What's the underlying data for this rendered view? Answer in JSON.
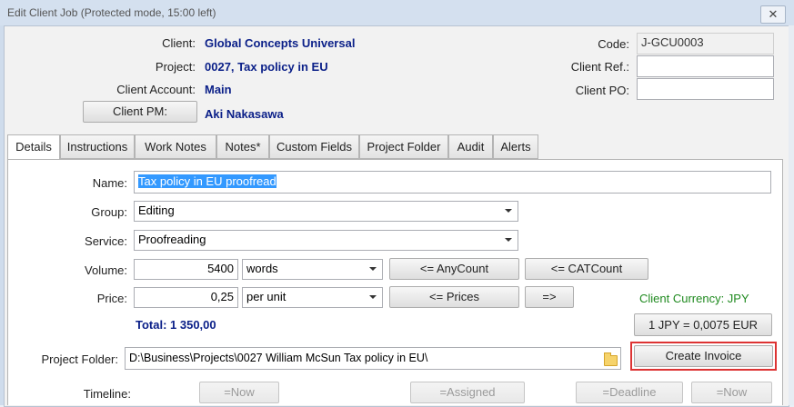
{
  "window": {
    "title": "Edit Client Job (Protected mode, 15:00 left)",
    "close_symbol": "✕"
  },
  "header": {
    "client_label": "Client:",
    "client_value": "Global Concepts Universal",
    "project_label": "Project:",
    "project_value": "0027, Tax policy in EU",
    "account_label": "Client Account:",
    "account_value": "Main",
    "pm_button": "Client PM:",
    "pm_value": "Aki Nakasawa",
    "code_label": "Code:",
    "code_value": "J-GCU0003",
    "ref_label": "Client Ref.:",
    "ref_value": "",
    "po_label": "Client PO:",
    "po_value": ""
  },
  "tabs": [
    {
      "label": "Details",
      "active": true
    },
    {
      "label": "Instructions"
    },
    {
      "label": "Work Notes"
    },
    {
      "label": "Notes*"
    },
    {
      "label": "Custom Fields"
    },
    {
      "label": "Project Folder"
    },
    {
      "label": "Audit"
    },
    {
      "label": "Alerts"
    }
  ],
  "details": {
    "name_label": "Name:",
    "name_value": "Tax policy in EU proofread",
    "group_label": "Group:",
    "group_value": "Editing",
    "service_label": "Service:",
    "service_value": "Proofreading",
    "volume_label": "Volume:",
    "volume_value": "5400",
    "volume_unit": "words",
    "anycount_button": "<= AnyCount",
    "catcount_button": "<= CATCount",
    "price_label": "Price:",
    "price_value": "0,25",
    "price_unit": "per unit",
    "prices_button": "<= Prices",
    "arrow_button": "=>",
    "client_currency": "Client Currency: JPY",
    "total": "Total: 1 350,00",
    "rate_button": "1 JPY = 0,0075 EUR",
    "folder_label": "Project Folder:",
    "folder_value": "D:\\Business\\Projects\\0027 William McSun Tax policy in EU\\",
    "create_invoice": "Create Invoice",
    "timeline_label": "Timeline:",
    "now1": "=Now",
    "assigned": "=Assigned",
    "deadline": "=Deadline",
    "now2": "=Now"
  },
  "colors": {
    "accent_text": "#0a1f88",
    "highlight": "#3399ff",
    "currency": "#1f8a1f",
    "frame": "#dd3333"
  },
  "icons": [
    "close-icon",
    "folder-icon",
    "dropdown-arrow-icon"
  ]
}
